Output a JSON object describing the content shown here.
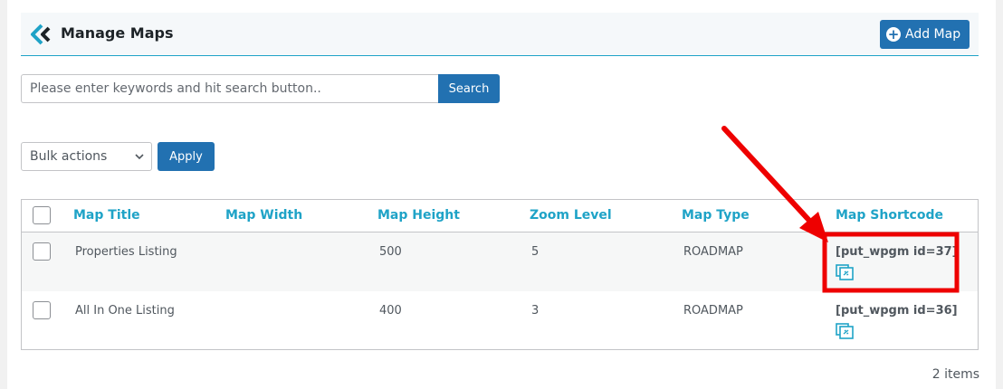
{
  "header": {
    "title": "Manage Maps",
    "add_button_label": "Add Map"
  },
  "search": {
    "placeholder": "Please enter keywords and hit search button..",
    "value": "",
    "button_label": "Search"
  },
  "bulk": {
    "selected": "Bulk actions",
    "apply_label": "Apply"
  },
  "table": {
    "columns": [
      "Map Title",
      "Map Width",
      "Map Height",
      "Zoom Level",
      "Map Type",
      "Map Shortcode"
    ],
    "rows": [
      {
        "title": "Properties Listing",
        "width": "",
        "height": "500",
        "zoom": "5",
        "type": "ROADMAP",
        "shortcode": "[put_wpgm id=37]"
      },
      {
        "title": "All In One Listing",
        "width": "",
        "height": "400",
        "zoom": "3",
        "type": "ROADMAP",
        "shortcode": "[put_wpgm id=36]"
      }
    ]
  },
  "footer": {
    "items_count": "2 items"
  },
  "colors": {
    "accent": "#1fa3c7",
    "button": "#2271b1",
    "highlight": "#ee0000"
  },
  "icons": {
    "logo": "plugin-logo-icon",
    "add": "plus-circle-icon",
    "copy": "copy-link-icon",
    "dropdown": "chevron-down-icon"
  }
}
